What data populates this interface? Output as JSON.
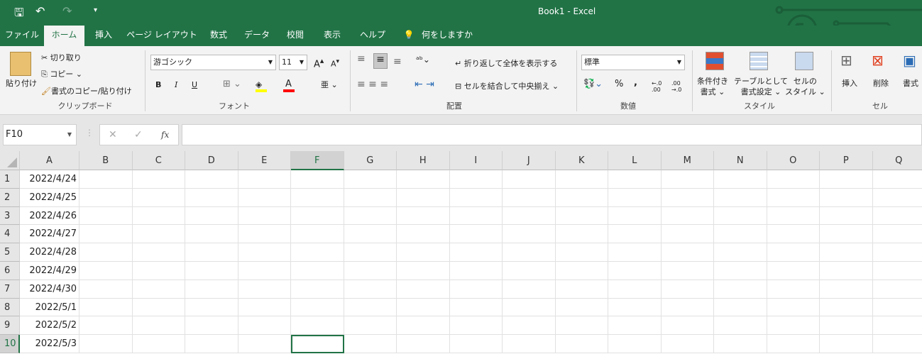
{
  "title": "Book1  -  Excel",
  "qat": {
    "save": "save-icon",
    "undo": "undo-icon",
    "redo": "redo-icon",
    "customize": "▾"
  },
  "tabs": [
    "ファイル",
    "ホーム",
    "挿入",
    "ページ レイアウト",
    "数式",
    "データ",
    "校閲",
    "表示",
    "ヘルプ"
  ],
  "tell_me": "何をしますか",
  "clipboard": {
    "paste": "貼り付け",
    "cut": "切り取り",
    "copy": "コピー",
    "format_painter": "書式のコピー/貼り付け",
    "label": "クリップボード"
  },
  "font": {
    "name": "游ゴシック",
    "size": "11",
    "bold": "B",
    "italic": "I",
    "underline": "U",
    "label": "フォント",
    "fill_color": "#ffff00",
    "font_color": "#ff0000"
  },
  "alignment": {
    "wrap": "折り返して全体を表示する",
    "merge": "セルを結合して中央揃え",
    "label": "配置"
  },
  "number": {
    "format": "標準",
    "percent": "%",
    "comma": ",",
    "inc": "←.0 .00",
    "dec": ".00 →.0",
    "label": "数値"
  },
  "styles": {
    "conditional": [
      "条件付き",
      "書式"
    ],
    "table": [
      "テーブルとして",
      "書式設定"
    ],
    "cell": [
      "セルの",
      "スタイル"
    ],
    "label": "スタイル"
  },
  "cells": {
    "insert": "挿入",
    "delete": "削除",
    "format": "書式",
    "label": "セル"
  },
  "name_box": "F10",
  "formula": "",
  "columns": [
    "A",
    "B",
    "C",
    "D",
    "E",
    "F",
    "G",
    "H",
    "I",
    "J",
    "K",
    "L",
    "M",
    "N",
    "O",
    "P",
    "Q"
  ],
  "rows": [
    "1",
    "2",
    "3",
    "4",
    "5",
    "6",
    "7",
    "8",
    "9",
    "10"
  ],
  "colA": [
    "2022/4/24",
    "2022/4/25",
    "2022/4/26",
    "2022/4/27",
    "2022/4/28",
    "2022/4/29",
    "2022/4/30",
    "2022/5/1",
    "2022/5/2",
    "2022/5/3"
  ],
  "selected": "F10"
}
